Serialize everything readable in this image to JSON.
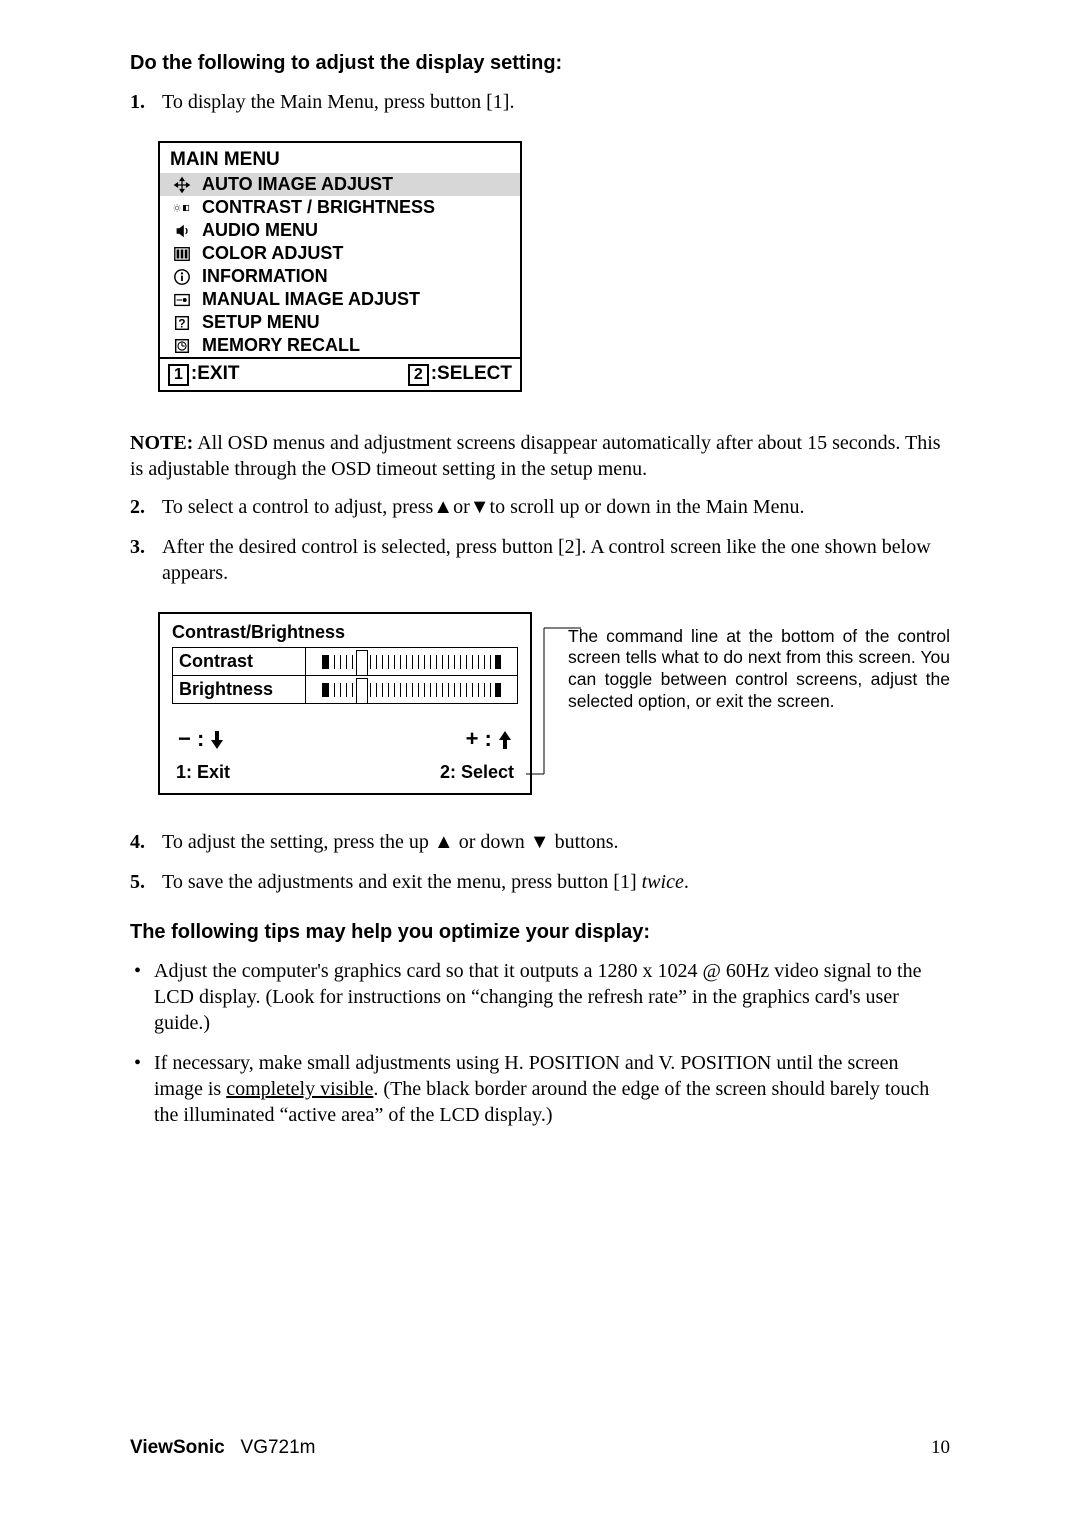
{
  "heading1": "Do the following to adjust the display setting:",
  "step1": {
    "num": "1.",
    "text": "To display the Main Menu, press button [1]."
  },
  "step2": {
    "num": "2.",
    "text": "To select a control to adjust, press▲or▼to scroll up or down in the Main Menu."
  },
  "step3": {
    "num": "3.",
    "text": "After the desired control is selected, press button [2]. A control screen like the one shown below appears."
  },
  "step4": {
    "num": "4.",
    "text": "To adjust the setting, press the up ▲ or down ▼ buttons."
  },
  "step5": {
    "num": "5.",
    "text_pre": "To save the adjustments and exit the menu, press button [1] ",
    "text_em": "twice",
    "text_post": "."
  },
  "mainmenu": {
    "title": "MAIN MENU",
    "items": [
      "AUTO IMAGE ADJUST",
      "CONTRAST / BRIGHTNESS",
      "AUDIO MENU",
      "COLOR ADJUST",
      "INFORMATION",
      "MANUAL IMAGE ADJUST",
      "SETUP MENU",
      "MEMORY RECALL"
    ],
    "footer_exit_key": "1",
    "footer_exit_label": ":EXIT",
    "footer_select_key": "2",
    "footer_select_label": ":SELECT"
  },
  "note": {
    "label": "NOTE:",
    "text": " All OSD menus and adjustment screens disappear automatically after about 15 seconds. This is adjustable through the OSD timeout setting in the setup menu."
  },
  "cb": {
    "title": "Contrast/Brightness",
    "row1": "Contrast",
    "row2": "Brightness",
    "adj_minus": "− : ⬇",
    "adj_plus": "+ : ⬆",
    "footer_exit": "1: Exit",
    "footer_select": "2: Select"
  },
  "caption": "The command line at the bottom of the control screen tells what to do next from this screen. You can toggle between control screens, adjust the selected option, or exit the screen.",
  "heading2": "The following tips may help you optimize your display:",
  "tip1": "Adjust the computer's graphics card so that it outputs a 1280 x 1024 @ 60Hz video signal to the LCD display. (Look for instructions on “changing the refresh rate” in the graphics card's user guide.)",
  "tip2_pre": "If necessary, make small adjustments using H. POSITION and V. POSITION until the screen image is ",
  "tip2_ul": "completely visible",
  "tip2_post": ". (The black border around the edge of the screen should barely touch the illuminated “active area” of the LCD display.)",
  "footer": {
    "brand": "ViewSonic",
    "model": "VG721m",
    "pagenum": "10"
  }
}
